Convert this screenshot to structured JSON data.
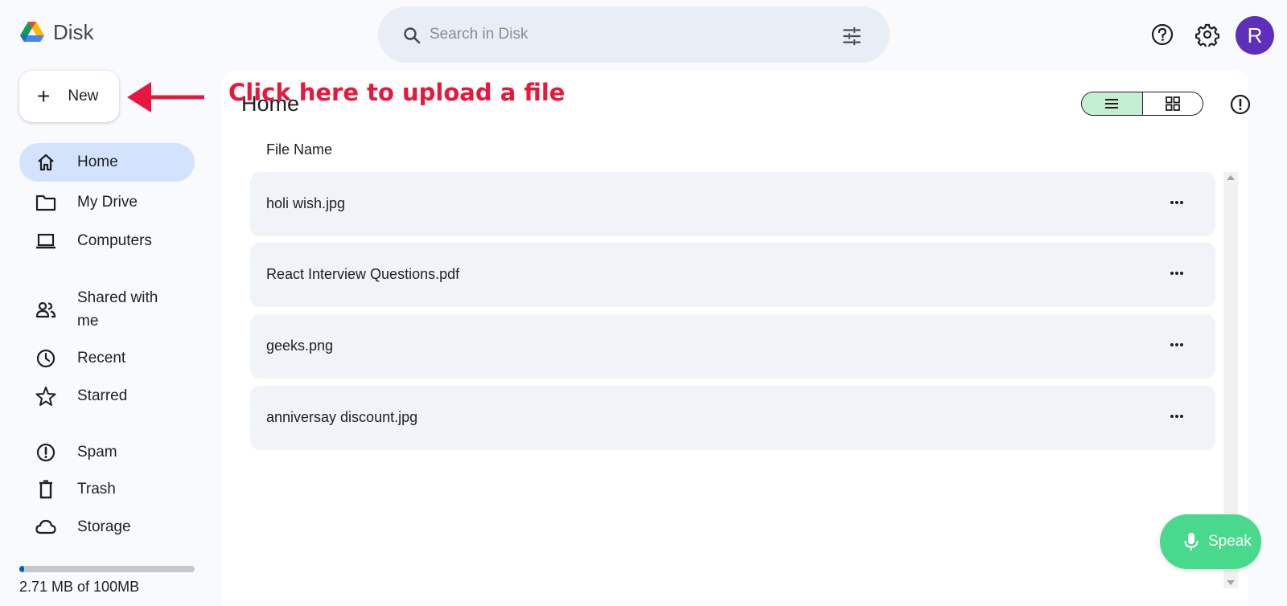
{
  "app": {
    "name": "Disk"
  },
  "search": {
    "placeholder": "Search in Disk"
  },
  "header": {
    "avatar_letter": "R"
  },
  "new_button": {
    "label": "New"
  },
  "annotation": {
    "text": "Click here to upload a file",
    "color": "#e8173c"
  },
  "sidebar": {
    "items": [
      {
        "label": "Home",
        "icon": "home-icon",
        "active": true
      },
      {
        "label": "My Drive",
        "icon": "folder-icon"
      },
      {
        "label": "Computers",
        "icon": "laptop-icon"
      },
      {
        "label": "Shared with me",
        "icon": "people-icon"
      },
      {
        "label": "Recent",
        "icon": "clock-icon"
      },
      {
        "label": "Starred",
        "icon": "star-icon"
      },
      {
        "label": "Spam",
        "icon": "spam-icon"
      },
      {
        "label": "Trash",
        "icon": "trash-icon"
      },
      {
        "label": "Storage",
        "icon": "cloud-icon"
      }
    ],
    "storage_text": "2.71 MB of 100MB",
    "storage_fraction": 0.0271
  },
  "main": {
    "title": "Home",
    "column_header": "File Name",
    "files": [
      {
        "name": "holi wish.jpg"
      },
      {
        "name": "React Interview Questions.pdf"
      },
      {
        "name": "geeks.png"
      },
      {
        "name": "anniversay discount.jpg"
      }
    ],
    "view_mode": "list"
  },
  "speak_button": {
    "label": "Speak",
    "color": "#49d98c"
  },
  "colors": {
    "accent": "#0b57d0",
    "avatar": "#5d2fbb",
    "active_nav": "#d3e3fd"
  }
}
